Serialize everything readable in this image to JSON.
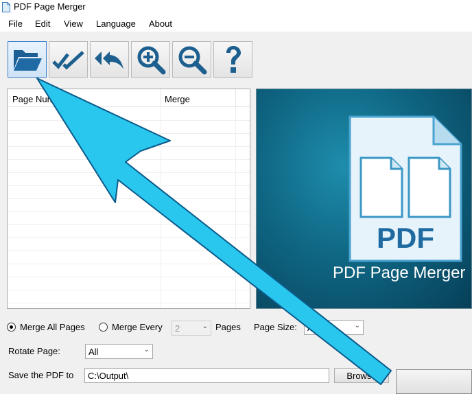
{
  "window": {
    "title": "PDF Page Merger",
    "icon": "pdf-file-icon"
  },
  "menu": [
    {
      "label": "File"
    },
    {
      "label": "Edit"
    },
    {
      "label": "View"
    },
    {
      "label": "Language"
    },
    {
      "label": "About"
    }
  ],
  "toolbar": [
    {
      "icon": "open-folder-icon",
      "active": true
    },
    {
      "icon": "check-all-icon"
    },
    {
      "icon": "reply-all-icon"
    },
    {
      "icon": "zoom-in-icon"
    },
    {
      "icon": "zoom-out-icon"
    },
    {
      "icon": "help-icon"
    }
  ],
  "table": {
    "columns": [
      "Page Num",
      "Merge"
    ],
    "rows": []
  },
  "preview": {
    "caption": "PDF Page Merger",
    "badge": "PDF"
  },
  "options": {
    "merge_all_label": "Merge All Pages",
    "merge_every_label": "Merge Every",
    "merge_every_value": "2",
    "pages_label": "Pages",
    "page_size_label": "Page Size:",
    "page_size_value": "A4",
    "rotate_label": "Rotate Page:",
    "rotate_value": "All",
    "save_label": "Save the PDF to",
    "save_path": "C:\\Output\\",
    "browse_label": "Browse"
  },
  "colors": {
    "arrow": "#29c6ee",
    "arrow_outline": "#0b5a8a",
    "preview_bg": "#0f6784"
  }
}
